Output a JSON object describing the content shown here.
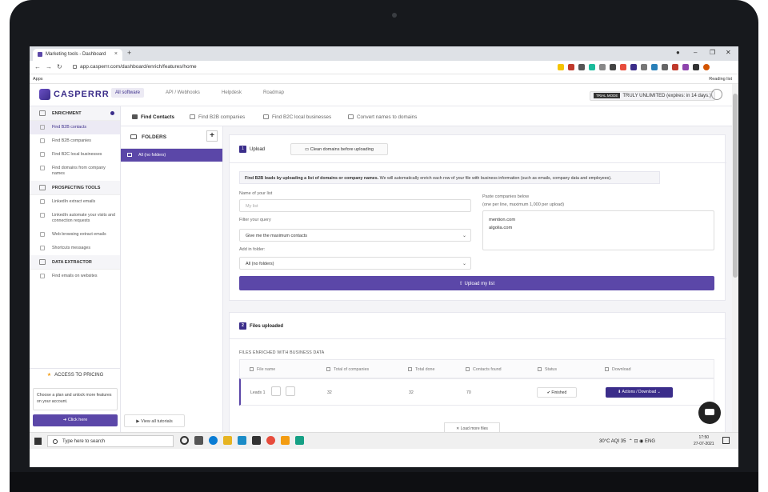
{
  "browser": {
    "tab_title": "Marketing tools - Dashboard",
    "tab_close": "×",
    "new_tab": "+",
    "url": "app.casperrr.com/dashboard/enrich/features/home",
    "apps_label": "Apps",
    "reading_list": "Reading list"
  },
  "header": {
    "logo_text": "CASPERRR",
    "nav": [
      "All software",
      "API / Webhooks",
      "Helpdesk",
      "Roadmap"
    ],
    "trial_badge": "TRIAL MODE",
    "trial_text": "TRULY UNLIMITED (expires: in 14 days.)"
  },
  "sidebar": {
    "groups": [
      {
        "title": "ENRICHMENT",
        "icon": "list-icon",
        "items": [
          "Find B2B contacts",
          "Find B2B companies",
          "Find B2C local businesses",
          "Find domains from company names"
        ]
      },
      {
        "title": "PROSPECTING TOOLS",
        "icon": "pickaxe-icon",
        "items": [
          "LinkedIn extract emails",
          "LinkedIn automate your visits and connection requests",
          "Web browsing extract emails",
          "Shortcuts messages"
        ]
      },
      {
        "title": "DATA EXTRACTOR",
        "icon": "extractor-icon",
        "items": [
          "Find emails on websites"
        ]
      }
    ],
    "pricing_label": "ACCESS TO PRICING",
    "plan_text": "Choose a plan and unlock more features on your account.",
    "click_here": "Click here",
    "tutorials": "View all tutorials"
  },
  "tabs": [
    "Find Contacts",
    "Find B2B companies",
    "Find B2C local businesses",
    "Convert names to domains"
  ],
  "folders": {
    "title": "FOLDERS",
    "add": "+",
    "selected": "All (no folders)"
  },
  "upload": {
    "step": "1",
    "tab_label": "Upload",
    "clean_button": "Clean domains before uploading",
    "info_bold": "Find B2B leads by uploading a list of domains or company names.",
    "info_rest": " We will automatically enrich each row of your file with business information (such as emails, company data and employees).",
    "name_label": "Name of your list",
    "name_placeholder": "My list",
    "filter_label": "Filter your query",
    "filter_value": "Give me the maximum contacts",
    "folder_label": "Add in folder:",
    "folder_value": "All (no folders)",
    "paste_label": "Paste companies below",
    "paste_hint": "(one per line, maximum 1,000 per upload)",
    "paste_lines": [
      "mention.com",
      "algolia.com"
    ],
    "upload_button": "Upload my list"
  },
  "files": {
    "step": "2",
    "title": "Files uploaded",
    "subheader": "FILES ENRICHED WITH BUSINESS DATA",
    "columns": [
      "File name",
      "Total of companies",
      "Total done",
      "Contacts found",
      "Status",
      "Download"
    ],
    "row": {
      "name": "Leads 1",
      "total": "32",
      "done": "32",
      "contacts": "70",
      "status": "Finished",
      "download": "Actions / Download"
    },
    "load_more": "Load more files"
  },
  "taskbar": {
    "search_placeholder": "Type here to search",
    "weather": "30°C AQI 35",
    "lang": "ENG",
    "time": "17:50",
    "date": "27-07-2021"
  },
  "colors": {
    "brand": "#5b47a8",
    "brand_dark": "#3b2d8a"
  }
}
